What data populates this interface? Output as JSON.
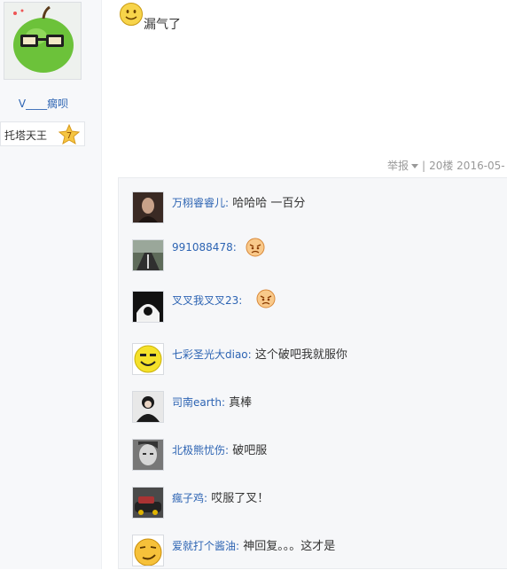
{
  "sidebar": {
    "username": "V____瘸呗",
    "rank_title": "托塔天王",
    "rank_level": "7"
  },
  "post": {
    "text": "漏气了",
    "emoji": "smile-emoji"
  },
  "meta": {
    "report_label": "举报",
    "floor": "20楼",
    "date": "2016-05-",
    "separator": "|"
  },
  "replies": [
    {
      "name": "万栩睿睿儿:",
      "content": "哈哈哈 一百分",
      "avatar": "portrait-dark-icon"
    },
    {
      "name": "991088478:",
      "content": "",
      "avatar": "road-photo-icon",
      "emoji": "angry-emoji"
    },
    {
      "name": "叉叉我叉叉23:",
      "content": "",
      "avatar": "bw-figure-icon",
      "emoji": "angry-emoji"
    },
    {
      "name": "七彩圣光大diao:",
      "content": "这个破吧我就服你",
      "avatar": "smiley-avatar-icon"
    },
    {
      "name": "司南earth:",
      "content": "真棒",
      "avatar": "person-black-icon"
    },
    {
      "name": "北极熊忧伤:",
      "content": "破吧服",
      "avatar": "bw-face-icon"
    },
    {
      "name": "瘋子鸡:",
      "content": "哎服了叉！",
      "avatar": "car-photo-icon"
    },
    {
      "name": "爱就打个酱油:",
      "content": "神回复。。。这才是",
      "avatar": "smirk-avatar-icon"
    }
  ]
}
